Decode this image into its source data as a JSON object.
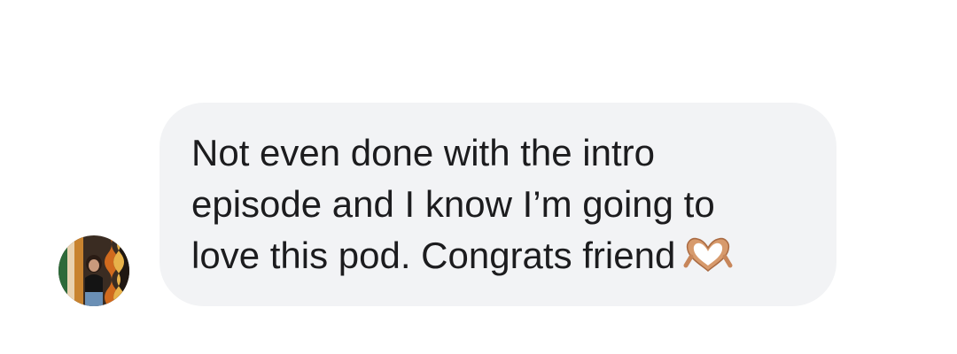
{
  "conversation": {
    "sender": {
      "avatar_icon": "profile-photo-avatar"
    },
    "message": {
      "lines": [
        "Not even done with the intro",
        "episode and I know I’m going to",
        "love this pod. Congrats friend"
      ],
      "emoji": "heart-hands-emoji",
      "bubble_color": "#f2f3f5",
      "text_color": "#1c1c1e"
    }
  }
}
